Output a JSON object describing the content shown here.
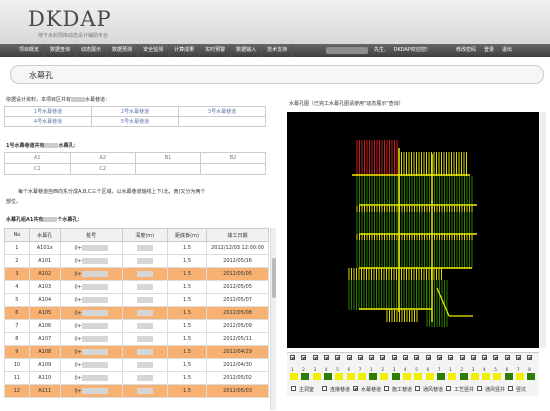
{
  "header": {
    "logo": "DKDAP",
    "subtitle": "地下水封洞库动态设计辅助平台"
  },
  "nav": {
    "items": [
      "项目概览",
      "数据查询",
      "动态展示",
      "数据预测",
      "安全监测",
      "计算成果",
      "实时预警",
      "数据输入",
      "技术支持"
    ],
    "user_suffix": "先生,",
    "welcome": "DKDAP欢迎您!",
    "change_password": "修改密码",
    "login": "登录",
    "logout": "退出"
  },
  "page": {
    "title": "水幕孔"
  },
  "left": {
    "intro": "依据设计资料，本项目区共有",
    "intro_tail": "水幕巷道：",
    "galleries": [
      "1号水幕巷道",
      "2号水幕巷道",
      "3号水幕巷道",
      "4号水幕巷道",
      "5号水幕巷道"
    ],
    "gallery_head": "1号水幕巷道共有",
    "gallery_head_tail": "水幕孔：",
    "zones": [
      "A1",
      "A2",
      "B1",
      "B2",
      "C1",
      "C2"
    ],
    "description_line1": "每个水幕巷道自西向东分成A,B,C三个区域，以水幕巷道轴线上下(北，南)又分为两个",
    "description_line2": "部位。",
    "table_caption": "水幕孔组A1共有",
    "table_caption_tail": "个水幕孔：",
    "table": {
      "headers": [
        "No",
        "水幕孔",
        "桩号",
        "深度(m)",
        "距底板(m)",
        "竣工日期"
      ],
      "rows": [
        {
          "no": "1",
          "hole": "A101x",
          "station": "0+",
          "dist": "1.5",
          "date": "2012/12/03 12:00:00",
          "highlight": false
        },
        {
          "no": "2",
          "hole": "A101",
          "station": "0+",
          "dist": "1.5",
          "date": "2012/05/16",
          "highlight": false
        },
        {
          "no": "3",
          "hole": "A102",
          "station": "0+",
          "dist": "1.5",
          "date": "2012/05/05",
          "highlight": true
        },
        {
          "no": "4",
          "hole": "A103",
          "station": "0+",
          "dist": "1.5",
          "date": "2012/05/05",
          "highlight": false
        },
        {
          "no": "5",
          "hole": "A104",
          "station": "0+",
          "dist": "1.5",
          "date": "2012/05/07",
          "highlight": false
        },
        {
          "no": "6",
          "hole": "A105",
          "station": "0+",
          "dist": "1.5",
          "date": "2012/05/08",
          "highlight": true
        },
        {
          "no": "7",
          "hole": "A106",
          "station": "0+",
          "dist": "1.5",
          "date": "2012/05/09",
          "highlight": false
        },
        {
          "no": "8",
          "hole": "A107",
          "station": "0+",
          "dist": "1.5",
          "date": "2012/05/11",
          "highlight": false
        },
        {
          "no": "9",
          "hole": "A108",
          "station": "0+",
          "dist": "1.5",
          "date": "2012/04/29",
          "highlight": true
        },
        {
          "no": "10",
          "hole": "A109",
          "station": "0+",
          "dist": "1.5",
          "date": "2012/04/30",
          "highlight": false
        },
        {
          "no": "11",
          "hole": "A110",
          "station": "0+",
          "dist": "1.5",
          "date": "2012/05/02",
          "highlight": false
        },
        {
          "no": "12",
          "hole": "A111",
          "station": "0+",
          "dist": "1.5",
          "date": "2012/05/03",
          "highlight": true
        }
      ]
    }
  },
  "right": {
    "map_caption": "水幕孔图（已完工水幕孔图请使用\"动态展示\"查询）",
    "zone_labels": [
      "A",
      "A",
      "A",
      "A",
      "A",
      "A",
      "A",
      "B",
      "B",
      "B",
      "B",
      "B",
      "B",
      "B",
      "C",
      "C",
      "C",
      "C",
      "C",
      "C",
      "C",
      "C"
    ],
    "legend": [
      "主洞室",
      "连接巷道",
      "水幕巷道",
      "施工巷道",
      "通风巷道",
      "工艺竖井",
      "通风竖井",
      "竖坑"
    ],
    "colors": {
      "hole_green": "#2e7d00",
      "hole_yellow": "#d8d800",
      "hole_red": "#c81e1e",
      "gallery_yellow": "#f0f000"
    }
  }
}
